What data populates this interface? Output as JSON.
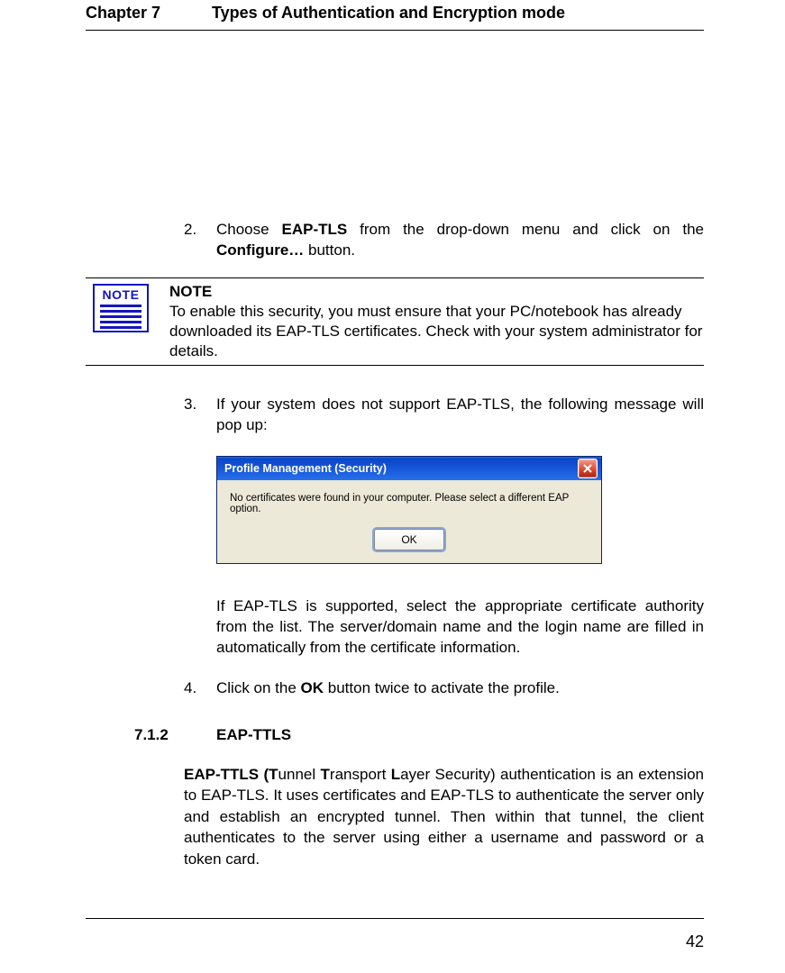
{
  "header": {
    "chapter": "Chapter 7",
    "title": "Types of Authentication and Encryption mode"
  },
  "steps": {
    "s2": {
      "num": "2.",
      "pre": "Choose ",
      "bold1": "EAP-TLS",
      "mid": " from the drop-down menu and click on the ",
      "bold2": "Configure…",
      "post": " button."
    },
    "s3": {
      "num": "3.",
      "text": "If your system does not support EAP-TLS, the following message will pop up:"
    },
    "s4": {
      "num": "4.",
      "pre": "Click on the ",
      "bold": "OK",
      "post": " button twice to activate the profile."
    }
  },
  "note": {
    "icon_label": "NOTE",
    "heading": "NOTE",
    "body": "To enable this security, you must ensure that your PC/notebook has already downloaded its EAP-TLS certificates. Check with your system administrator for details."
  },
  "dialog": {
    "title": "Profile Management (Security)",
    "message": "No certificates were found in your computer.  Please select a different EAP option.",
    "ok": "OK"
  },
  "para_after_dialog": "If EAP-TLS is supported, select the appropriate certificate authority from the list. The server/domain name and the login name are filled in automatically from the certificate information.",
  "section": {
    "num": "7.1.2",
    "title": "EAP-TTLS",
    "b1": "EAP-TTLS (T",
    "t1": "unnel ",
    "b2": "T",
    "t2": "ransport ",
    "b3": "L",
    "t3": "ayer Security) authentication is an extension to EAP-TLS. It uses certificates and EAP-TLS to authenticate the server only and establish an encrypted tunnel. Then within that tunnel, the client authenticates to the server using either a username and password or a token card."
  },
  "page_number": "42"
}
